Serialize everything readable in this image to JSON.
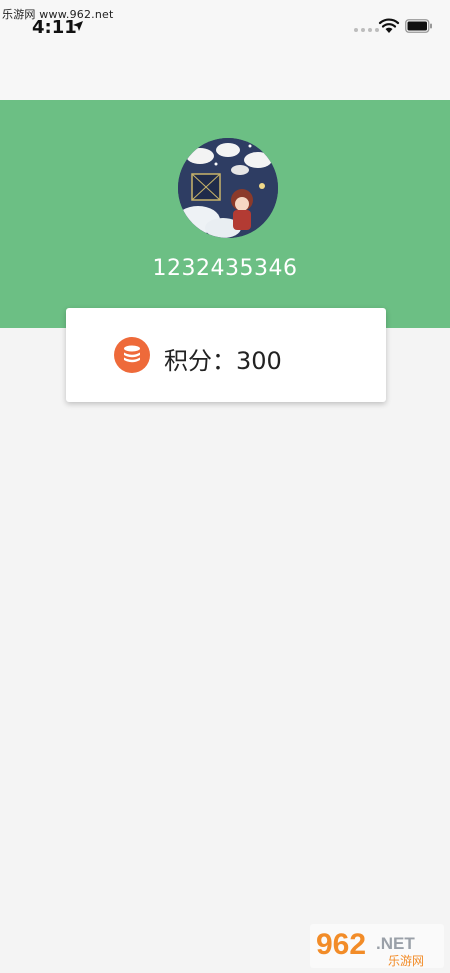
{
  "watermark": {
    "top_text": "乐游网 www.962.net",
    "bottom_brand": "962",
    "bottom_suffix": ".NET",
    "bottom_sub": "乐游网"
  },
  "status_bar": {
    "time": "4:11"
  },
  "profile": {
    "user_id": "1232435346"
  },
  "points": {
    "label": "积分：",
    "value": "300"
  },
  "colors": {
    "header_green": "#6cbf84",
    "coin_orange": "#ee6a3a",
    "background": "#f4f4f4"
  },
  "icons": {
    "location": "location-arrow-icon",
    "wifi": "wifi-icon",
    "battery": "battery-icon",
    "coin": "coin-stack-icon"
  }
}
